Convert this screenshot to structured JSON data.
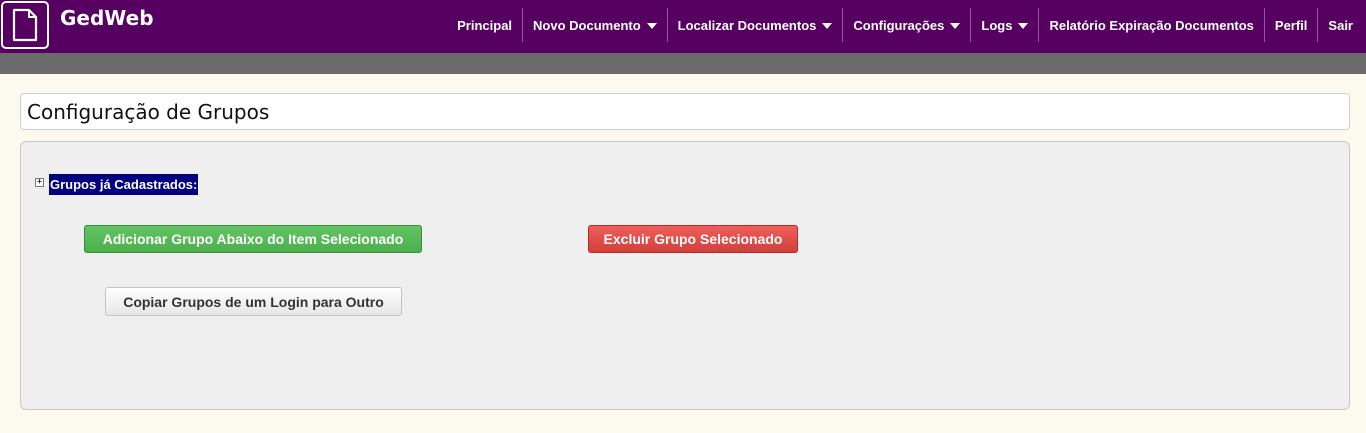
{
  "brand": {
    "name": "GedWeb",
    "icon": "document-icon"
  },
  "nav": {
    "items": [
      {
        "label": "Principal",
        "dropdown": false
      },
      {
        "label": "Novo Documento",
        "dropdown": true
      },
      {
        "label": "Localizar Documentos",
        "dropdown": true
      },
      {
        "label": "Configurações",
        "dropdown": true
      },
      {
        "label": "Logs",
        "dropdown": true
      },
      {
        "label": "Relatório Expiração Documentos",
        "dropdown": false
      },
      {
        "label": "Perfil",
        "dropdown": false
      },
      {
        "label": "Sair",
        "dropdown": false
      }
    ]
  },
  "page": {
    "title": "Configuração de Grupos"
  },
  "tree": {
    "root_label": "Grupos já Cadastrados:",
    "expand_symbol": "+"
  },
  "actions": {
    "add_label": "Adicionar Grupo Abaixo do Item Selecionado",
    "delete_label": "Excluir Grupo Selecionado",
    "copy_label": "Copiar Grupos de um Login para Outro"
  },
  "colors": {
    "navbar": "#560061",
    "subbar": "#6b6b6b",
    "background": "#fcf9ef",
    "selection": "#000080",
    "success": "#5cb85c",
    "danger": "#d9534f"
  }
}
